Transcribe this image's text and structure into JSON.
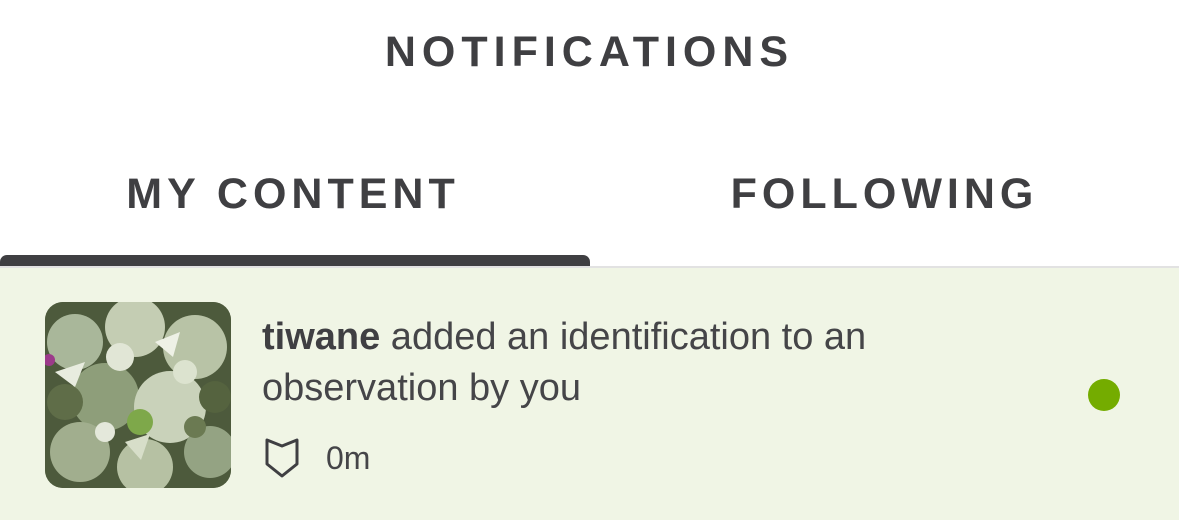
{
  "header": {
    "title": "NOTIFICATIONS"
  },
  "tabs": [
    {
      "label": "MY CONTENT",
      "active": true
    },
    {
      "label": "FOLLOWING",
      "active": false
    }
  ],
  "notifications": [
    {
      "username": "tiwane",
      "message": " added an identification to an observation by you",
      "time": "0m",
      "icon": "identification-shield-icon",
      "thumbnail": "plant-observation-photo",
      "unread": true
    }
  ],
  "colors": {
    "text": "#3f3f42",
    "row_background": "#f0f5e5",
    "unread_dot": "#74ac00",
    "tab_indicator": "#3f3f42"
  }
}
